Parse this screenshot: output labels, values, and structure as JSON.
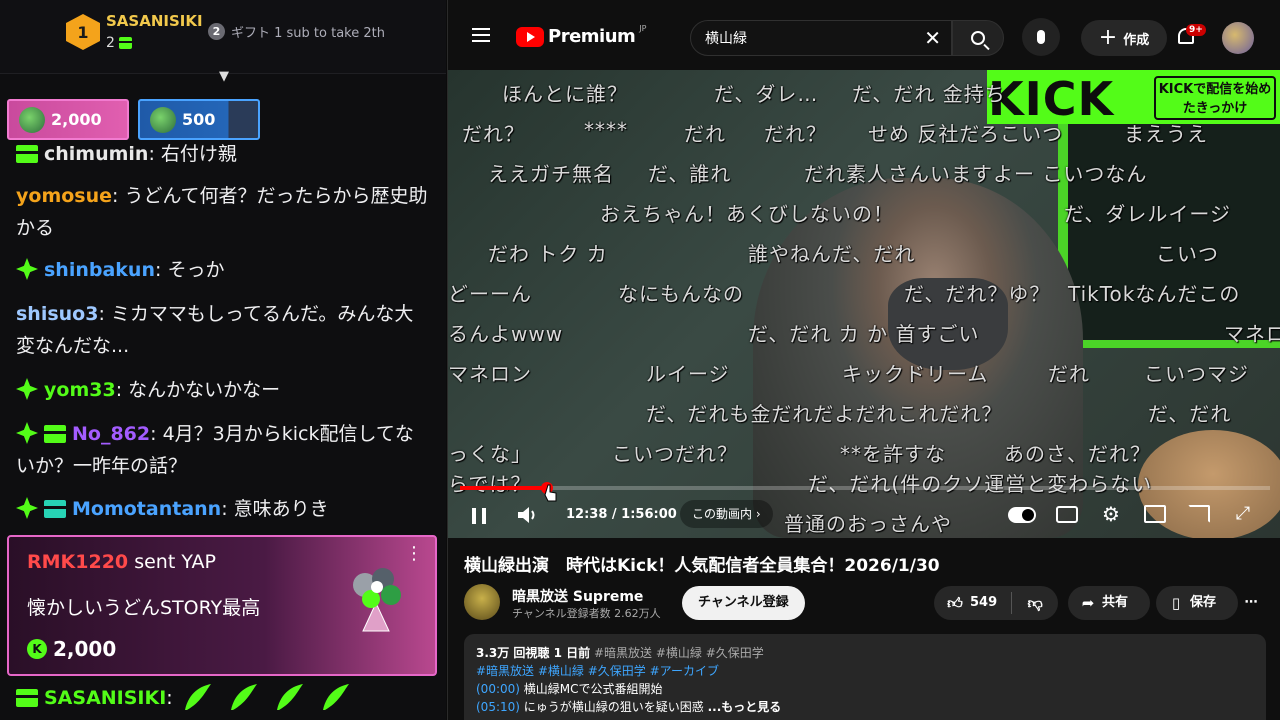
{
  "chat": {
    "leaderboard": {
      "rank1": "1",
      "user": "SASANISIKI",
      "count": "2",
      "rank2": "2",
      "second_text": "ギフト 1 sub to take 2th"
    },
    "pills": [
      {
        "amount": "2,000"
      },
      {
        "amount": "500"
      }
    ],
    "messages": [
      {
        "user": "chimumin",
        "text": "右付け親",
        "color": "#53fc18"
      },
      {
        "user": "yomosue",
        "text": "うどんて何者？だったらから歴史助かる",
        "color": "#f4a31b"
      },
      {
        "user": "shinbakun",
        "text": "そっか",
        "color": "#4aa3ff"
      },
      {
        "user": "shisuo3",
        "text": "ミカママもしってるんだ。みんな大変なんだな...",
        "color": "#9ec8ff"
      },
      {
        "user": "yom33",
        "text": "なんかないかなー",
        "color": "#53fc18"
      },
      {
        "user": "No_862",
        "text": "4月？3月からkick配信してないか？一昨年の話？",
        "color": "#a35cff"
      },
      {
        "user": "Momotantann",
        "text": "意味ありき",
        "color": "#4aa3ff"
      }
    ],
    "gift": {
      "user": "RMK1220",
      "action": " sent YAP",
      "message": "懐かしいうどんSTORY最高",
      "amount": "2,000"
    },
    "last": {
      "user": "SASANISIKI"
    }
  },
  "youtube": {
    "logo": "Premium",
    "logo_region": "JP",
    "search_value": "横山緑",
    "create_label": "作成",
    "notif_badge": "9+",
    "video": {
      "banner_text": "KICK",
      "banner_box": "KICKで配信を始めたきっかけ",
      "time": "12:38 / 1:56:00",
      "chapter": "この動画内 ›",
      "progress": 0.108,
      "danmaku": [
        "ほんとに誰？",
        "だ、ダレ…",
        "だ、だれ 金持ち",
        "だれ？",
        "****",
        "だれ",
        "だれ？",
        "せめ 反社だろこいつ",
        "まえうえ",
        "ええガチ無名",
        "だ、誰れ",
        "だれ素人さんいますよー こいつなん",
        "おえちゃん！あくびしないの！",
        "だ、ダレルイージ",
        "だわ トク カ",
        "誰やねんだ、だれ",
        "こいつ",
        "どーーん",
        "なにもんなの",
        "だ、だれ？ゆ？",
        "TikTokなんだこの",
        "るんよwww",
        "だ、だれ カ か 首すごい",
        "マネロン",
        "マネロン",
        "ルイージ",
        "キックドリーム",
        "だれ",
        "こいつマジ",
        "だ、だれも金だれだよだれこれだれ？",
        "だ、だれ",
        "っくな」",
        "こいつだれ？",
        "**を許すな",
        "あのさ、だれ？",
        "らでは？",
        "だ、だれ(件のクソ運営と変わらない",
        "普通のおっさんや"
      ]
    },
    "title": "横山緑出演　時代はKick！人気配信者全員集合！2026/1/30",
    "channel": {
      "name": "暗黒放送 Supreme",
      "subs": "チャンネル登録者数 2.62万人",
      "subscribe": "チャンネル登録"
    },
    "actions": {
      "likes": "549",
      "share": "共有",
      "save": "保存"
    },
    "description": {
      "stats": "3.3万 回視聴  1 日前",
      "tags1": "#暗黒放送 #横山緑 #久保田学",
      "tags2": "#暗黒放送 #横山緑 #久保田学 #アーカイブ",
      "line1_ts": "(00:00)",
      "line1": " 横山緑MCで公式番組開始",
      "line2_ts": "(05:10)",
      "line2": " にゅうが横山緑の狙いを疑い困惑 ",
      "more": "...もっと見る"
    }
  }
}
